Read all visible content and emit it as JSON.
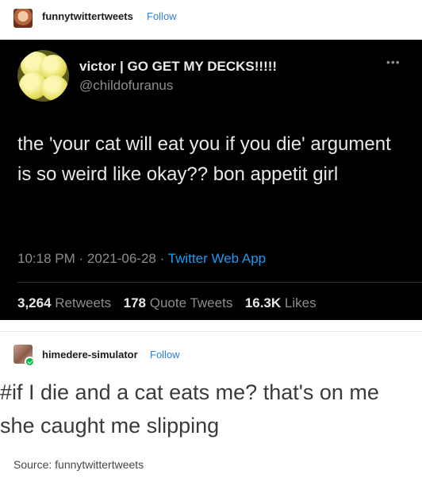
{
  "post": {
    "username": "funnytwittertweets",
    "follow_label": "Follow"
  },
  "tweet": {
    "display_name": "victor | GO GET MY DECKS!!!!!",
    "handle": "@childofuranus",
    "more_icon": "more-dots-icon",
    "text": "the 'your cat will eat you if you die' argument is so weird like okay?? bon appetit girl",
    "time": "10:18 PM",
    "date": "2021-06-28",
    "source_app": "Twitter Web App",
    "stats": {
      "retweets_count": "3,264",
      "retweets_label": "Retweets",
      "quotes_count": "178",
      "quotes_label": "Quote Tweets",
      "likes_count": "16.3K",
      "likes_label": "Likes"
    }
  },
  "reblog": {
    "username": "himedere-simulator",
    "follow_label": "Follow",
    "line1": "#if I die and a cat eats me? that's on me",
    "line2": "she caught me slipping"
  },
  "source": {
    "label": "Source: funnytwittertweets"
  },
  "colors": {
    "follow": "#2f7fd6",
    "tweet_background": "#000000",
    "tweet_link": "#1d9bf0",
    "verified_badge": "#00b84a"
  }
}
